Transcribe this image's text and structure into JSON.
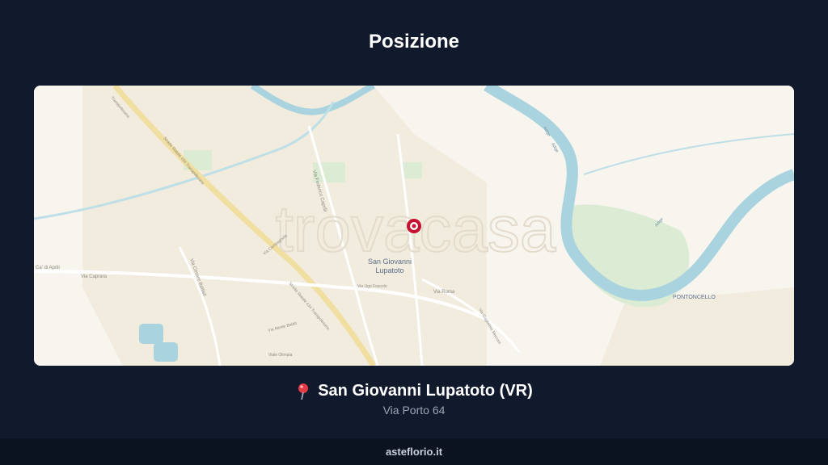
{
  "page": {
    "title": "Posizione"
  },
  "map": {
    "watermark": "trovacasa",
    "marker_icon": "location-marker-icon",
    "labels": {
      "town": "San Giovanni",
      "town2": "Lupatoto",
      "district": "PONTONCELLO",
      "via_roma": "Via Roma",
      "via_ugo": "Via Ugo Foscolo",
      "via_caprara": "Via Caprara",
      "ca_aprili": "Ca' di Aprili",
      "via_cesare": "Via Cesare Battisti",
      "via_federico": "Via Federico Caprilli",
      "ss434_a": "Strada Statale 434 Transpolesana",
      "ss434_b": "Strada Statale 434 Transpolesana",
      "via_guglielmo": "Via Guglielmo Marconi",
      "via_monte": "Via Monte Baldo",
      "viale_olimpia": "Viale Olimpia",
      "via_campagnola": "Via Campagnola",
      "adige_1": "Adige",
      "adige_2": "Adige",
      "adige_3": "Adige",
      "transpolesana": "Transpolesana"
    },
    "colors": {
      "land": "#f8f4ee",
      "river": "#a9d3de",
      "green": "#dcebd3",
      "marker": "#c8102e"
    }
  },
  "location": {
    "pin_icon": "pushpin-icon",
    "city": "San Giovanni Lupatoto (VR)",
    "address": "Via Porto 64"
  },
  "footer": {
    "site": "asteflorio.it"
  }
}
